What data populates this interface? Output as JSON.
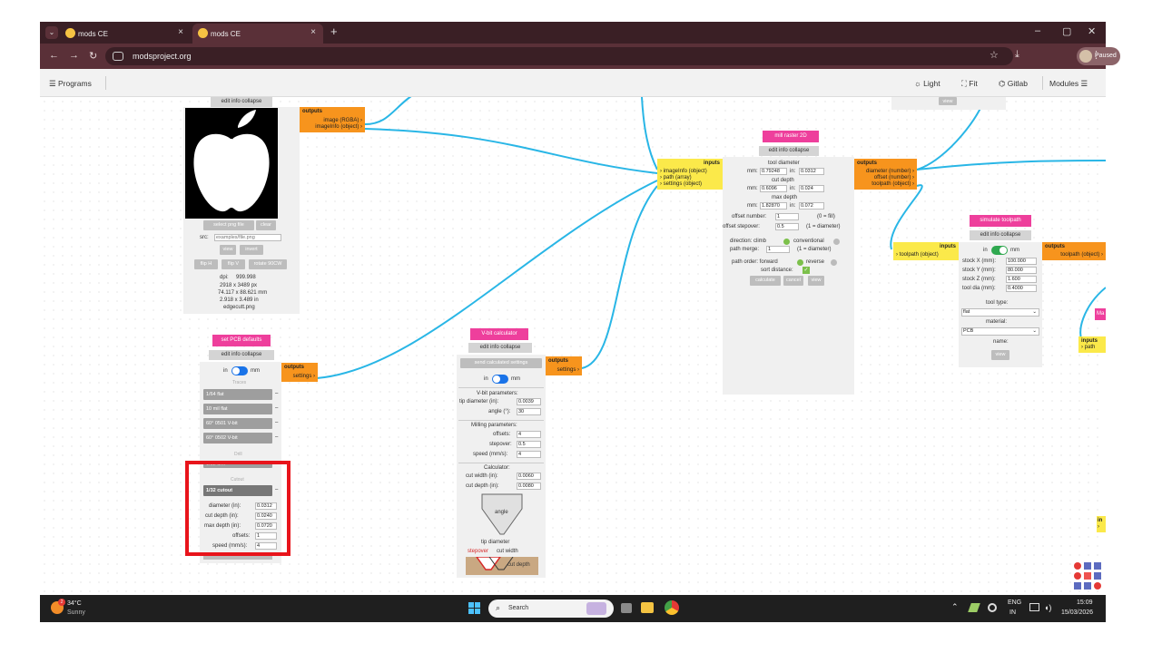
{
  "browser": {
    "tabs": [
      {
        "title": "mods CE",
        "close": "×"
      },
      {
        "title": "mods CE",
        "close": "×"
      }
    ],
    "tabs_menu": "⌄",
    "new_tab": "+",
    "window_controls": [
      "–",
      "▢",
      "✕"
    ],
    "nav": {
      "back": "←",
      "forward": "→",
      "reload": "↻"
    },
    "url": "modsproject.org",
    "star": "☆",
    "download": "⤓",
    "profile_status": "Paused",
    "menu": "⋮"
  },
  "app_header": {
    "programs": "☰ Programs",
    "light": "☼ Light",
    "fit": "⛶ Fit",
    "gitlab": "⌬ Gitlab",
    "modules": "Modules ☰"
  },
  "image_module": {
    "edit_info_collapse": "edit info collapse",
    "select_png": "select png file",
    "clear": "clear",
    "src_label": "src:",
    "src_placeholder": "examples/file.png",
    "view": "view",
    "invert": "invert",
    "flip_h": "flip H",
    "flip_v": "flip V",
    "rotate": "rotate 90CW",
    "dpi_label": "dpi:",
    "dpi_value": "999.998",
    "px": "2918 x 3489 px",
    "mm": "74.117 x 88.621 mm",
    "in": "2.918 x 3.489 in",
    "filename": "edgecutt.png",
    "outputs_title": "outputs",
    "out1": "image (RGBA) ›",
    "out2": "imageInfo (object) ›"
  },
  "pcb_module": {
    "title": "set PCB defaults",
    "edit_info_collapse": "edit info collapse",
    "unit_in": "in",
    "unit_mm": "mm",
    "traces_label": "Traces",
    "traces": [
      "1/64 flat",
      "10 mil flat",
      "60° 0501 V-bit",
      "60° 0502 V-bit"
    ],
    "drill_label": "Drill",
    "drill_btn": "1/32 drill",
    "cutout_label": "Cutout",
    "cutout_btn": "1/32 cutout",
    "diameter_label": "diameter (in):",
    "diameter_value": "0.0312",
    "cut_depth_label": "cut depth (in):",
    "cut_depth_value": "0.0240",
    "max_depth_label": "max depth (in):",
    "max_depth_value": "0.0720",
    "offsets_label": "offsets:",
    "offsets_value": "1",
    "speed_label": "speed (mm/s):",
    "speed_value": "4",
    "outputs_title": "outputs",
    "out1": "settings ›",
    "dash": "–"
  },
  "vbit_module": {
    "title": "V-bit calculator",
    "edit_info_collapse": "edit info collapse",
    "send": "send calculated settings",
    "unit_in": "in",
    "unit_mm": "mm",
    "vbit_params": "V-bit parameters:",
    "tip_label": "tip diameter (in):",
    "tip_value": "0.0039",
    "angle_label": "angle (°):",
    "angle_value": "30",
    "milling_params": "Milling parameters:",
    "offsets_label": "offsets:",
    "offsets_value": "4",
    "stepover_label": "stepover:",
    "stepover_value": "0.5",
    "speed_label": "speed (mm/s):",
    "speed_value": "4",
    "calculator": "Calculator:",
    "cut_width_label": "cut width (in):",
    "cut_width_value": "0.0060",
    "cut_depth_label": "cut depth (in):",
    "cut_depth_value": "0.0080",
    "angle_text": "angle",
    "tip_text": "tip diameter",
    "stepover_text": "stepover",
    "cut_width_text": "cut width",
    "cut_depth_text": "cut depth",
    "outputs_title": "outputs",
    "out1": "settings ›"
  },
  "mill_module": {
    "title": "mill raster 2D",
    "edit_info_collapse": "edit info collapse",
    "inputs_title": "inputs",
    "in1": "› imageInfo (object)",
    "in2": "› path (array)",
    "in3": "› settings (object)",
    "tool_diameter": "tool diameter",
    "mm_label": "mm:",
    "in_label": "in:",
    "td_mm": "0.79248",
    "td_in": "0.0312",
    "cut_depth": "cut depth",
    "cd_mm": "0.6096",
    "cd_in": "0.024",
    "max_depth": "max depth",
    "md_mm": "1.82870",
    "md_in": "0.072",
    "offset_number_label": "offset number:",
    "offset_number_value": "1",
    "offset_number_hint": "(0 = fill)",
    "offset_stepover_label": "offset stepover:",
    "offset_stepover_value": "0.5",
    "offset_stepover_hint": "(1 = diameter)",
    "direction_label": "direction: climb",
    "conventional": "conventional",
    "path_merge_label": "path merge:",
    "path_merge_value": "1",
    "path_merge_hint": "(1 = diameter)",
    "path_order_label": "path order: forward",
    "reverse": "reverse",
    "sort_distance": "sort distance:",
    "check": "✓",
    "calculate": "calculate",
    "cancel": "cancel",
    "view": "view",
    "outputs_title": "outputs",
    "out1": "diameter (number) ›",
    "out2": "offset (number) ›",
    "out3": "toolpath (object) ›"
  },
  "sim_module": {
    "title": "simulate toolpath",
    "edit_info_collapse": "edit info collapse",
    "inputs_title": "inputs",
    "in1": "› toolpath (object)",
    "unit_in": "in",
    "unit_mm": "mm",
    "stock_x_label": "stock X (mm):",
    "stock_x_value": "100.000",
    "stock_y_label": "stock Y (mm):",
    "stock_y_value": "80.000",
    "stock_z_label": "stock Z (mm):",
    "stock_z_value": "1.600",
    "tool_dia_label": "tool dia (mm):",
    "tool_dia_value": "0.4000",
    "tool_type_label": "tool type:",
    "tool_type_value": "flat",
    "material_label": "material:",
    "material_value": "PCB",
    "name_label": "name:",
    "view": "view",
    "outputs_title": "outputs",
    "out1": "toolpath (object) ›"
  },
  "offscreen": {
    "top_view": "view",
    "right_inputs": "inputs",
    "right_in1": "› path",
    "right_partial": "Ma",
    "bottom_partial1": "in",
    "bottom_partial2": "›"
  },
  "taskbar": {
    "temp": "34°C",
    "weather": "Sunny",
    "badge": "2",
    "search": "Search",
    "lang1": "ENG",
    "lang2": "IN",
    "time": "15:09",
    "date": "15/03/2026",
    "tray_up": "⌃"
  },
  "colors": {
    "title_pink": "#ee3f9c",
    "input_yellow": "#fbe94a",
    "output_orange": "#f7941d",
    "wire_cyan": "#29b6e6",
    "highlight_red": "#e8141b"
  }
}
